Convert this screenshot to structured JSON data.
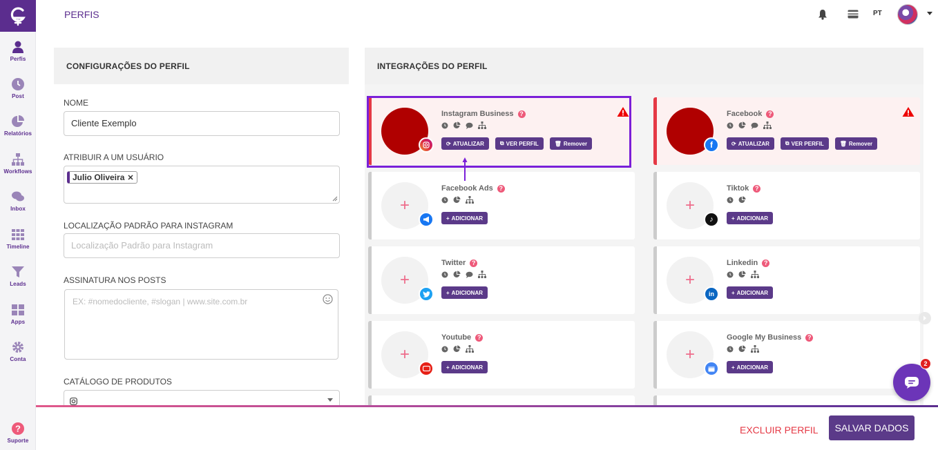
{
  "nav": {
    "items": [
      {
        "label": "Perfis",
        "icon": "user-icon"
      },
      {
        "label": "Post",
        "icon": "clock-icon"
      },
      {
        "label": "Relatórios",
        "icon": "pie-icon"
      },
      {
        "label": "Workflows",
        "icon": "sitemap-icon"
      },
      {
        "label": "Inbox",
        "icon": "chat-icon"
      },
      {
        "label": "Timeline",
        "icon": "grid-icon"
      },
      {
        "label": "Leads",
        "icon": "filter-icon"
      },
      {
        "label": "Apps",
        "icon": "apps-icon"
      },
      {
        "label": "Conta",
        "icon": "gear-icon"
      }
    ],
    "support": "Suporte"
  },
  "header": {
    "title": "PERFIS",
    "lang": "PT"
  },
  "settings": {
    "title": "CONFIGURAÇÕES DO PERFIL",
    "name_label": "NOME",
    "name_value": "Cliente Exemplo",
    "assign_label": "ATRIBUIR A UM USUÁRIO",
    "assigned_user": "Julio Oliveira",
    "location_label": "LOCALIZAÇÃO PADRÃO PARA INSTAGRAM",
    "location_placeholder": "Localização Padrão para Instagram",
    "signature_label": "ASSINATURA NOS POSTS",
    "signature_placeholder": "EX: #nomedocliente, #slogan | www.site.com.br",
    "catalog_label": "CATÁLOGO DE PRODUTOS"
  },
  "integrations": {
    "title": "INTEGRAÇÕES DO PERFIL",
    "buttons": {
      "update": "ATUALIZAR",
      "view": "VER PERFIL",
      "remove": "Remover",
      "add": "ADICIONAR"
    },
    "cards": [
      {
        "name": "Instagram Business",
        "connected": true,
        "badge": "instagram-icon"
      },
      {
        "name": "Facebook",
        "connected": true,
        "badge": "facebook-icon"
      },
      {
        "name": "Facebook Ads",
        "connected": false,
        "badge": "megaphone-icon"
      },
      {
        "name": "Tiktok",
        "connected": false,
        "badge": "tiktok-icon"
      },
      {
        "name": "Twitter",
        "connected": false,
        "badge": "twitter-icon"
      },
      {
        "name": "Linkedin",
        "connected": false,
        "badge": "linkedin-icon"
      },
      {
        "name": "Youtube",
        "connected": false,
        "badge": "youtube-icon"
      },
      {
        "name": "Google My Business",
        "connected": false,
        "badge": "google-business-icon"
      }
    ]
  },
  "chat": {
    "badge_count": "2"
  },
  "footer": {
    "delete": "EXCLUIR PERFIL",
    "save": "SALVAR DADOS"
  },
  "colors": {
    "primary": "#5b2d8e",
    "alert": "#e53945",
    "highlight": "#7a1fd8"
  }
}
